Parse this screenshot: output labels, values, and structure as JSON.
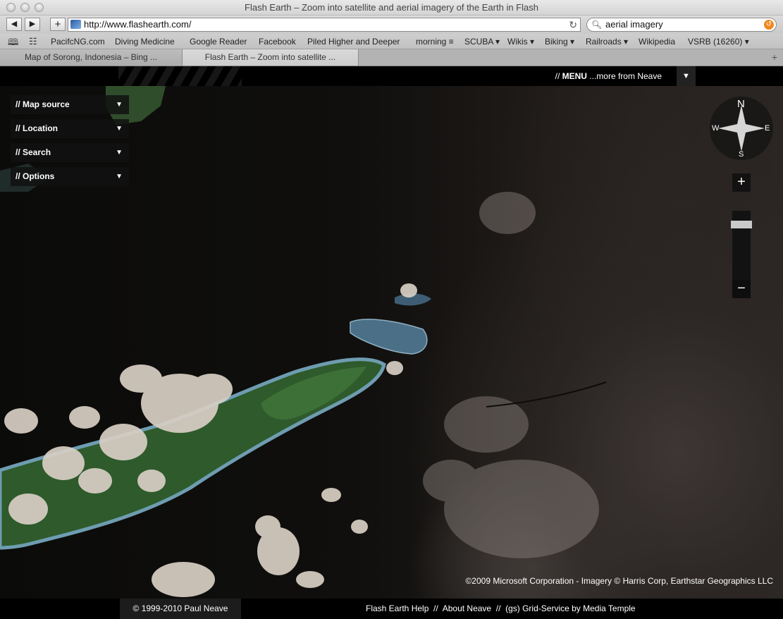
{
  "window": {
    "title": "Flash Earth – Zoom into satellite and aerial imagery of the Earth in Flash"
  },
  "toolbar": {
    "back_label": "◀",
    "forward_label": "▶",
    "add_label": "+",
    "url": "http://www.flashearth.com/",
    "reload_label": "↻",
    "search_value": "aerial imagery"
  },
  "bookmarks": {
    "items": [
      "PacifcNG.com",
      "Diving Medicine",
      "Google Reader",
      "Facebook",
      "Piled Higher and Deeper",
      "morning ≡",
      "SCUBA ▾",
      "Wikis ▾",
      "Biking ▾",
      "Railroads ▾",
      "Wikipedia",
      "VSRB (16260) ▾"
    ]
  },
  "tabs": [
    {
      "label": "Map of Sorong, Indonesia – Bing ..."
    },
    {
      "label": "Flash Earth – Zoom into satellite ..."
    }
  ],
  "menu": {
    "prefix": "// ",
    "menu_word": "MENU",
    "suffix": " ...more from Neave",
    "arrow": "▼"
  },
  "panel": {
    "items": [
      {
        "label": "// Map source"
      },
      {
        "label": "// Location"
      },
      {
        "label": "// Search"
      },
      {
        "label": "// Options"
      }
    ],
    "arrow": "▼"
  },
  "compass": {
    "n": "N",
    "s": "S",
    "e": "E",
    "w": "W"
  },
  "zoom": {
    "plus": "+",
    "minus": "−"
  },
  "map": {
    "attribution": "©2009 Microsoft Corporation - Imagery © Harris Corp, Earthstar Geographics LLC"
  },
  "footer": {
    "copyright": "© 1999-2010 Paul Neave",
    "links": "Flash Earth Help  //  About Neave  //  (gs) Grid-Service by Media Temple"
  },
  "colors": {
    "page_bg": "#000000",
    "panel_bg": "#121212",
    "accent_search_clear": "#f0881e"
  }
}
